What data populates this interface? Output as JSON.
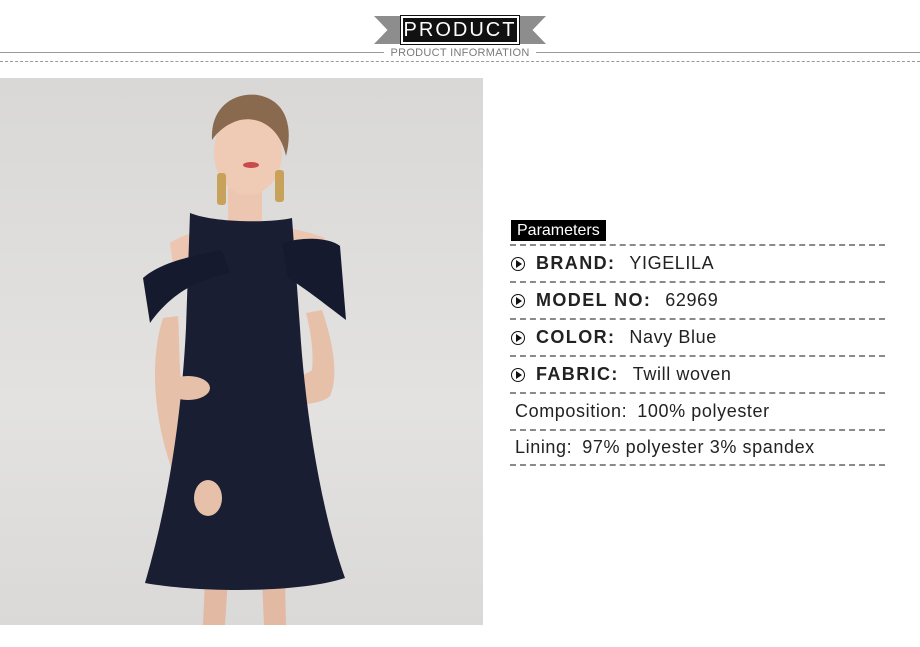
{
  "header": {
    "title": "PRODUCT",
    "subtitle": "PRODUCT INFORMATION"
  },
  "image": {
    "icon": "model-in-navy-dress-photo"
  },
  "parameters": {
    "title": "Parameters",
    "rows": [
      {
        "label": "BRAND:",
        "value": "YIGELILA"
      },
      {
        "label": "MODEL NO:",
        "value": "62969"
      },
      {
        "label": "COLOR:",
        "value": "Navy Blue"
      },
      {
        "label": "FABRIC:",
        "value": "Twill woven"
      },
      {
        "label": "Composition:",
        "value": "100% polyester"
      },
      {
        "label": "Lining:",
        "value": "97% polyester 3% spandex"
      }
    ]
  },
  "colors": {
    "background": "#ffffff",
    "dress": "#1a1e33",
    "banner": "#111111"
  }
}
